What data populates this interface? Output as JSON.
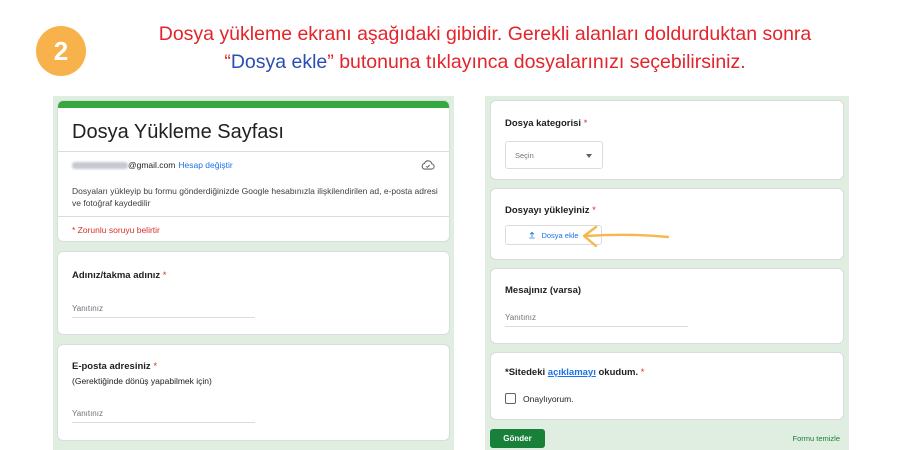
{
  "step": {
    "number": "2",
    "caption_line1": "Dosya yükleme ekranı aşağıdaki gibidir. Gerekli alanları doldurduktan sonra",
    "caption_quote_open": "“",
    "caption_highlight": "Dosya ekle",
    "caption_quote_close": "”",
    "caption_line2_rest": " butonuna tıklayınca dosyalarınızı seçebilirsiniz."
  },
  "form": {
    "title": "Dosya Yükleme Sayfası",
    "account_email_domain": "@gmail.com",
    "switch_account": "Hesap değiştir",
    "description": "Dosyaları yükleyip bu formu gönderdiğinizde Google hesabınızla ilişkilendirilen ad, e-posta adresi ve fotoğraf kaydedilir",
    "required_note": "* Zorunlu soruyu belirtir",
    "questions": {
      "name": {
        "label": "Adınız/takma adınız",
        "req": "*",
        "placeholder": "Yanıtınız"
      },
      "email": {
        "label": "E-posta adresiniz",
        "req": "*",
        "sub": "(Gerektiğinde dönüş yapabilmek için)",
        "placeholder": "Yanıtınız"
      },
      "category": {
        "label": "Dosya kategorisi",
        "req": "*",
        "select_value": "Seçin"
      },
      "upload": {
        "label": "Dosyayı yükleyiniz",
        "req": "*",
        "button": "Dosya ekle"
      },
      "message": {
        "label": "Mesajınız (varsa)",
        "placeholder": "Yanıtınız"
      },
      "agree": {
        "label_prefix": "*Sitedeki ",
        "label_link": "açıklamayı",
        "label_suffix": " okudum.",
        "req": "*",
        "checkbox_label": "Onaylıyorum."
      }
    },
    "submit": "Gönder",
    "clear": "Formu temizle"
  },
  "colors": {
    "accent_green": "#36a840",
    "badge_orange": "#f8b24b",
    "caption_red": "#e3242b",
    "caption_blue": "#2a4db3",
    "panel_bg": "#dfeee0",
    "arrow": "#f6b84e"
  },
  "icons": {
    "cloud": "cloud-icon",
    "upload": "upload-icon",
    "arrow": "arrow-left-icon",
    "dropdown": "chevron-down-icon"
  }
}
